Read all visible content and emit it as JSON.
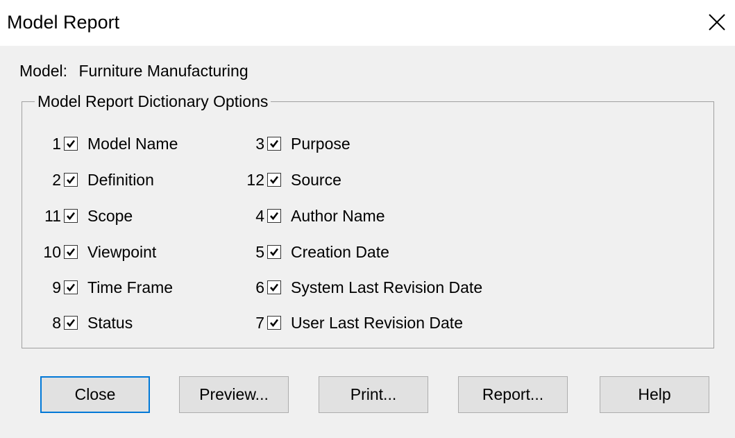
{
  "window": {
    "title": "Model Report"
  },
  "model": {
    "label": "Model:",
    "value": "Furniture Manufacturing"
  },
  "group": {
    "title": "Model Report Dictionary Options"
  },
  "options_left": [
    {
      "num": "1",
      "label": "Model Name",
      "checked": true
    },
    {
      "num": "2",
      "label": "Definition",
      "checked": true
    },
    {
      "num": "11",
      "label": "Scope",
      "checked": true
    },
    {
      "num": "10",
      "label": "Viewpoint",
      "checked": true
    },
    {
      "num": "9",
      "label": "Time Frame",
      "checked": true
    },
    {
      "num": "8",
      "label": "Status",
      "checked": true
    }
  ],
  "options_right": [
    {
      "num": "3",
      "label": "Purpose",
      "checked": true
    },
    {
      "num": "12",
      "label": "Source",
      "checked": true
    },
    {
      "num": "4",
      "label": "Author Name",
      "checked": true
    },
    {
      "num": "5",
      "label": "Creation Date",
      "checked": true
    },
    {
      "num": "6",
      "label": "System Last Revision Date",
      "checked": true
    },
    {
      "num": "7",
      "label": "User Last Revision Date",
      "checked": true
    }
  ],
  "buttons": {
    "close": "Close",
    "preview": "Preview...",
    "print": "Print...",
    "report": "Report...",
    "help": "Help"
  },
  "icons": {
    "window_close": "close-icon",
    "check": "checkmark-icon"
  }
}
